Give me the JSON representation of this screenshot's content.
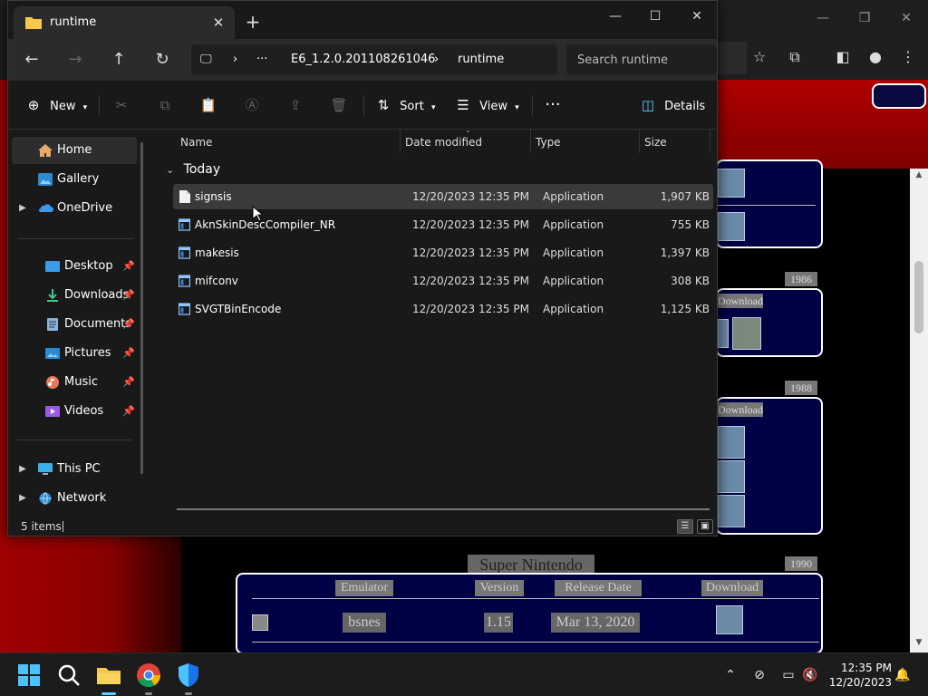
{
  "explorer": {
    "tab_title": "runtime",
    "breadcrumb": [
      "E6_1.2.0.201108261046",
      "runtime"
    ],
    "search_placeholder": "Search runtime",
    "toolbar": {
      "new": "New",
      "sort": "Sort",
      "view": "View",
      "details": "Details"
    },
    "sidebar": {
      "quick": [
        {
          "label": "Home"
        },
        {
          "label": "Gallery"
        },
        {
          "label": "OneDrive"
        }
      ],
      "pinned": [
        {
          "label": "Desktop"
        },
        {
          "label": "Downloads"
        },
        {
          "label": "Documents"
        },
        {
          "label": "Pictures"
        },
        {
          "label": "Music"
        },
        {
          "label": "Videos"
        }
      ],
      "devices": [
        {
          "label": "This PC"
        },
        {
          "label": "Network"
        }
      ]
    },
    "columns": {
      "name": "Name",
      "date": "Date modified",
      "type": "Type",
      "size": "Size"
    },
    "group": "Today",
    "files": [
      {
        "name": "signsis",
        "date": "12/20/2023 12:35 PM",
        "type": "Application",
        "size": "1,907 KB"
      },
      {
        "name": "AknSkinDescCompiler_NR",
        "date": "12/20/2023 12:35 PM",
        "type": "Application",
        "size": "755 KB"
      },
      {
        "name": "makesis",
        "date": "12/20/2023 12:35 PM",
        "type": "Application",
        "size": "1,397 KB"
      },
      {
        "name": "mifconv",
        "date": "12/20/2023 12:35 PM",
        "type": "Application",
        "size": "308 KB"
      },
      {
        "name": "SVGTBinEncode",
        "date": "12/20/2023 12:35 PM",
        "type": "Application",
        "size": "1,125 KB"
      }
    ],
    "status": "5 items"
  },
  "webpage": {
    "years": [
      "1986",
      "1988",
      "1990"
    ],
    "download": "Download",
    "snes_title": "Super Nintendo",
    "table_headers": [
      "Emulator",
      "Version",
      "Release Date",
      "Download"
    ],
    "table_row": {
      "emulator": "bsnes",
      "version": "1.15",
      "date": "Mar 13, 2020"
    }
  },
  "taskbar": {
    "time": "12:35 PM",
    "date": "12/20/2023"
  },
  "colors": {
    "accent": "#60cdff",
    "folder": "#f7c84a",
    "web_red": "#a00000",
    "web_navy": "#000044"
  }
}
